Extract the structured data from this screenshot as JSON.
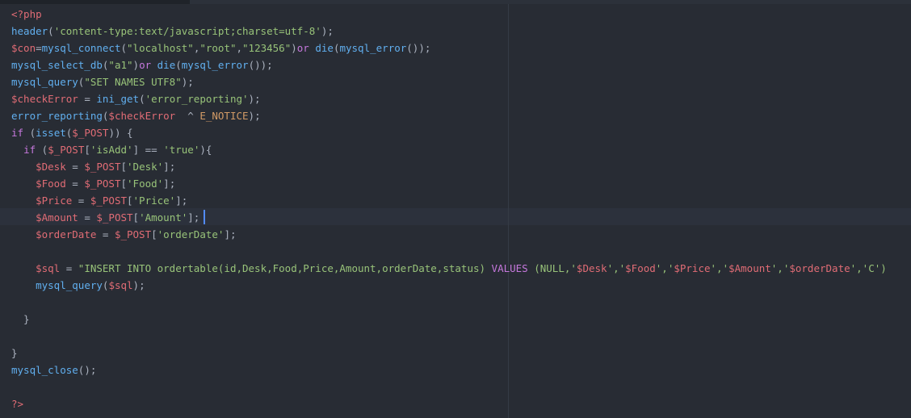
{
  "editor": {
    "language": "php",
    "colors": {
      "background": "#282c34",
      "active_line": "#2c313c",
      "cursor": "#528bff",
      "plain": "#abb2bf",
      "tag": "#e06c75",
      "function": "#61afef",
      "string": "#98c379",
      "variable": "#e06c75",
      "keyword": "#c678dd",
      "constant": "#d19a66"
    },
    "cursor_line": 13,
    "lines": [
      [
        {
          "t": "tag",
          "v": "<?php"
        }
      ],
      [
        {
          "t": "func",
          "v": "header"
        },
        {
          "t": "plain",
          "v": "("
        },
        {
          "t": "str",
          "v": "'content-type:text/javascript;charset=utf-8'"
        },
        {
          "t": "plain",
          "v": ");"
        }
      ],
      [
        {
          "t": "var",
          "v": "$con"
        },
        {
          "t": "plain",
          "v": "="
        },
        {
          "t": "func",
          "v": "mysql_connect"
        },
        {
          "t": "plain",
          "v": "("
        },
        {
          "t": "str",
          "v": "\"localhost\""
        },
        {
          "t": "plain",
          "v": ","
        },
        {
          "t": "str",
          "v": "\"root\""
        },
        {
          "t": "plain",
          "v": ","
        },
        {
          "t": "str",
          "v": "\"123456\""
        },
        {
          "t": "plain",
          "v": ")"
        },
        {
          "t": "kw",
          "v": "or"
        },
        {
          "t": "plain",
          "v": " "
        },
        {
          "t": "func",
          "v": "die"
        },
        {
          "t": "plain",
          "v": "("
        },
        {
          "t": "func",
          "v": "mysql_error"
        },
        {
          "t": "plain",
          "v": "());"
        }
      ],
      [
        {
          "t": "func",
          "v": "mysql_select_db"
        },
        {
          "t": "plain",
          "v": "("
        },
        {
          "t": "str",
          "v": "\"a1\""
        },
        {
          "t": "plain",
          "v": ")"
        },
        {
          "t": "kw",
          "v": "or"
        },
        {
          "t": "plain",
          "v": " "
        },
        {
          "t": "func",
          "v": "die"
        },
        {
          "t": "plain",
          "v": "("
        },
        {
          "t": "func",
          "v": "mysql_error"
        },
        {
          "t": "plain",
          "v": "());"
        }
      ],
      [
        {
          "t": "func",
          "v": "mysql_query"
        },
        {
          "t": "plain",
          "v": "("
        },
        {
          "t": "str",
          "v": "\"SET NAMES UTF8\""
        },
        {
          "t": "plain",
          "v": ");"
        }
      ],
      [
        {
          "t": "var",
          "v": "$checkError"
        },
        {
          "t": "plain",
          "v": " = "
        },
        {
          "t": "func",
          "v": "ini_get"
        },
        {
          "t": "plain",
          "v": "("
        },
        {
          "t": "str",
          "v": "'error_reporting'"
        },
        {
          "t": "plain",
          "v": ");"
        }
      ],
      [
        {
          "t": "func",
          "v": "error_reporting"
        },
        {
          "t": "plain",
          "v": "("
        },
        {
          "t": "var",
          "v": "$checkError"
        },
        {
          "t": "plain",
          "v": "  ^ "
        },
        {
          "t": "const",
          "v": "E_NOTICE"
        },
        {
          "t": "plain",
          "v": ");"
        }
      ],
      [
        {
          "t": "kw",
          "v": "if"
        },
        {
          "t": "plain",
          "v": " ("
        },
        {
          "t": "func",
          "v": "isset"
        },
        {
          "t": "plain",
          "v": "("
        },
        {
          "t": "var",
          "v": "$_POST"
        },
        {
          "t": "plain",
          "v": ")) {"
        }
      ],
      [
        {
          "t": "plain",
          "v": "  "
        },
        {
          "t": "kw",
          "v": "if"
        },
        {
          "t": "plain",
          "v": " ("
        },
        {
          "t": "var",
          "v": "$_POST"
        },
        {
          "t": "plain",
          "v": "["
        },
        {
          "t": "str",
          "v": "'isAdd'"
        },
        {
          "t": "plain",
          "v": "] == "
        },
        {
          "t": "str",
          "v": "'true'"
        },
        {
          "t": "plain",
          "v": "){"
        }
      ],
      [
        {
          "t": "plain",
          "v": "    "
        },
        {
          "t": "var",
          "v": "$Desk"
        },
        {
          "t": "plain",
          "v": " = "
        },
        {
          "t": "var",
          "v": "$_POST"
        },
        {
          "t": "plain",
          "v": "["
        },
        {
          "t": "str",
          "v": "'Desk'"
        },
        {
          "t": "plain",
          "v": "];"
        }
      ],
      [
        {
          "t": "plain",
          "v": "    "
        },
        {
          "t": "var",
          "v": "$Food"
        },
        {
          "t": "plain",
          "v": " = "
        },
        {
          "t": "var",
          "v": "$_POST"
        },
        {
          "t": "plain",
          "v": "["
        },
        {
          "t": "str",
          "v": "'Food'"
        },
        {
          "t": "plain",
          "v": "];"
        }
      ],
      [
        {
          "t": "plain",
          "v": "    "
        },
        {
          "t": "var",
          "v": "$Price"
        },
        {
          "t": "plain",
          "v": " = "
        },
        {
          "t": "var",
          "v": "$_POST"
        },
        {
          "t": "plain",
          "v": "["
        },
        {
          "t": "str",
          "v": "'Price'"
        },
        {
          "t": "plain",
          "v": "];"
        }
      ],
      [
        {
          "t": "plain",
          "v": "    "
        },
        {
          "t": "var",
          "v": "$Amount"
        },
        {
          "t": "plain",
          "v": " = "
        },
        {
          "t": "var",
          "v": "$_POST"
        },
        {
          "t": "plain",
          "v": "["
        },
        {
          "t": "str",
          "v": "'Amount'"
        },
        {
          "t": "plain",
          "v": "];"
        }
      ],
      [
        {
          "t": "plain",
          "v": "    "
        },
        {
          "t": "var",
          "v": "$orderDate"
        },
        {
          "t": "plain",
          "v": " = "
        },
        {
          "t": "var",
          "v": "$_POST"
        },
        {
          "t": "plain",
          "v": "["
        },
        {
          "t": "str",
          "v": "'orderDate'"
        },
        {
          "t": "plain",
          "v": "];"
        }
      ],
      [],
      [
        {
          "t": "plain",
          "v": "    "
        },
        {
          "t": "var",
          "v": "$sql"
        },
        {
          "t": "plain",
          "v": " = "
        },
        {
          "t": "str",
          "v": "\"INSERT INTO ordertable(id,Desk,Food,Price,Amount,orderDate,status) "
        },
        {
          "t": "kw",
          "v": "VALUES"
        },
        {
          "t": "str",
          "v": " (NULL,'"
        },
        {
          "t": "var",
          "v": "$Desk"
        },
        {
          "t": "str",
          "v": "','"
        },
        {
          "t": "var",
          "v": "$Food"
        },
        {
          "t": "str",
          "v": "','"
        },
        {
          "t": "var",
          "v": "$Price"
        },
        {
          "t": "str",
          "v": "','"
        },
        {
          "t": "var",
          "v": "$Amount"
        },
        {
          "t": "str",
          "v": "','"
        },
        {
          "t": "var",
          "v": "$orderDate"
        },
        {
          "t": "str",
          "v": "','C')"
        }
      ],
      [
        {
          "t": "plain",
          "v": "    "
        },
        {
          "t": "func",
          "v": "mysql_query"
        },
        {
          "t": "plain",
          "v": "("
        },
        {
          "t": "var",
          "v": "$sql"
        },
        {
          "t": "plain",
          "v": ");"
        }
      ],
      [],
      [
        {
          "t": "plain",
          "v": "  }"
        }
      ],
      [],
      [
        {
          "t": "plain",
          "v": "}"
        }
      ],
      [
        {
          "t": "func",
          "v": "mysql_close"
        },
        {
          "t": "plain",
          "v": "();"
        }
      ],
      [],
      [
        {
          "t": "tag",
          "v": "?>"
        }
      ]
    ]
  }
}
